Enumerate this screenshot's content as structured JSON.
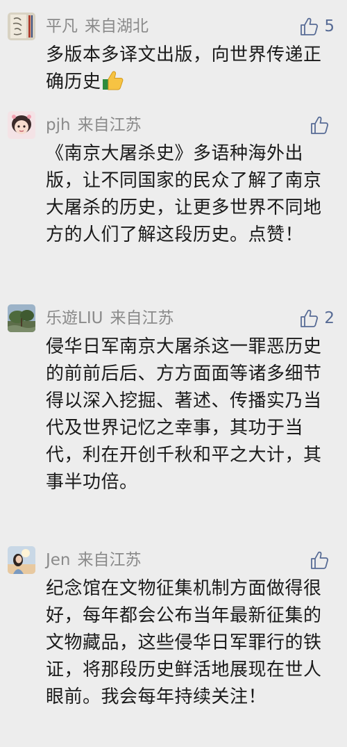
{
  "comments": [
    {
      "name": "平凡",
      "location": "来自湖北",
      "likes": "5",
      "text": "多版本多译文出版，向世界传递正确历史"
    },
    {
      "name": "pjh",
      "location": "来自江苏",
      "likes": "",
      "text": "《南京大屠杀史》多语种海外出版，让不同国家的民众了解了南京大屠杀的历史，让更多世界不同地方的人们了解这段历史。点赞！"
    },
    {
      "name": "乐遊LIU",
      "location": "来自江苏",
      "likes": "2",
      "text": "侵华日军南京大屠杀这一罪恶历史的前前后后、方方面面等诸多细节得以深入挖掘、著述、传播实乃当代及世界记忆之幸事，其功于当代，利在开创千秋和平之大计，其事半功倍。"
    },
    {
      "name": "Jen",
      "location": "来自江苏",
      "likes": "",
      "text": "纪念馆在文物征集机制方面做得很好，每年都会公布当年最新征集的文物藏品，这些侵华日军罪行的铁证，将那段历史鲜活地展现在世人眼前。我会每年持续关注！"
    }
  ],
  "icons": {
    "like": "thumbs-up-outline-icon",
    "emoji": "thumbs-up-emoji-icon"
  },
  "colors": {
    "background": "#ededed",
    "name": "#8a8a8a",
    "like": "#576b95",
    "text": "#1a1a1a"
  }
}
